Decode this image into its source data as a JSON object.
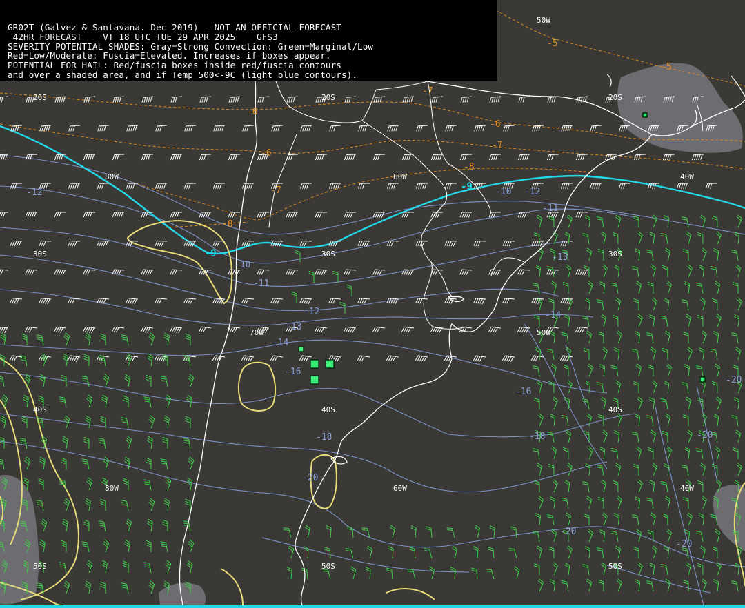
{
  "header": {
    "line1": "GR02T (Galvez & Santavana. Dec 2019) - NOT AN OFFICIAL FORECAST",
    "line2": " 42HR FORECAST    VT 18 UTC TUE 29 APR 2025    GFS3",
    "line3": "SEVERITY POTENTIAL SHADES: Gray=Strong Convection: Green=Marginal/Low",
    "line4": "Red=Low/Moderate: Fuscia=Elevated. Increases if boxes appear.",
    "line5": "POTENTIAL FOR HAIL: Red/fuscia boxes inside red/fuscia contours",
    "line6": "and over a shaded area, and if Temp 500<-9C (light blue contours)."
  },
  "grid_labels": {
    "lon_50w_top": "50W",
    "lat_20s_left": "20S",
    "lat_20s_mid": "20S",
    "lat_20s_right": "20S",
    "lon_80w_upper": "80W",
    "lon_60w_upper": "60W",
    "lon_40w_upper": "40W",
    "lat_30s_left": "30S",
    "lat_30s_mid": "30S",
    "lat_30s_right": "30S",
    "lon_70w_mid": "70W",
    "lon_50w_mid": "50W",
    "lat_40s_left": "40S",
    "lat_40s_mid": "40S",
    "lat_40s_right": "40S",
    "lon_80w_lower": "80W",
    "lon_60w_lower": "60W",
    "lon_40w_lower": "40W",
    "lat_50s_left": "50S",
    "lat_50s_mid": "50S",
    "lat_50s_right": "50S"
  },
  "isotherm_labels": {
    "orange": [
      "-5",
      "-5",
      "-6",
      "-6",
      "-6",
      "-7",
      "-7",
      "-7",
      "-8",
      "-8"
    ],
    "cyan": [
      "-9",
      "-9"
    ],
    "blue": [
      "-12",
      "-10",
      "-11",
      "-12",
      "-10",
      "-11",
      "-12",
      "-13",
      "-13",
      "-14",
      "-14",
      "-16",
      "-16",
      "-18",
      "-18",
      "-20",
      "-20",
      "-20",
      "-20",
      "-20"
    ]
  },
  "colors": {
    "background": "#3a3935",
    "coastline": "#ffffff",
    "temp_isotherm": "#7d92c9",
    "warm_isotherm": "#d78a20",
    "minus9_isotherm": "#22d8e8",
    "severity_contour": "#e6dc78",
    "gray_shade": "#77767b",
    "green_barbs": "#3fd04a",
    "hail_box": "#3cf07a"
  }
}
